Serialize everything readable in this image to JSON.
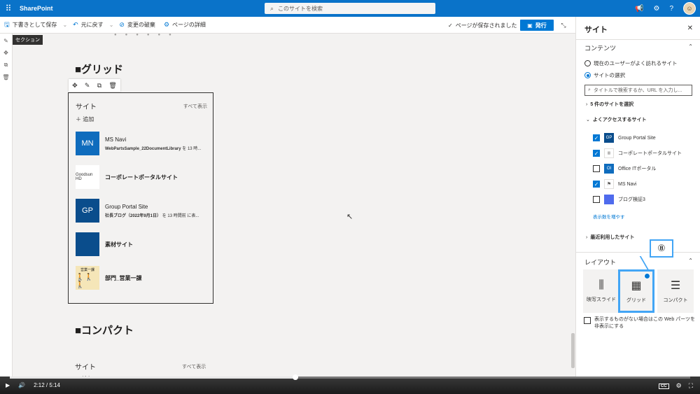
{
  "suitebar": {
    "app_name": "SharePoint",
    "search_placeholder": "このサイトを検索",
    "icons": [
      "waffle-icon",
      "megaphone-icon",
      "gear-icon",
      "help-icon",
      "avatar"
    ]
  },
  "cmdbar": {
    "save_draft": "下書きとして保存",
    "undo": "元に戻す",
    "discard": "変更の破棄",
    "page_details": "ページの詳細",
    "saved_status": "ページが保存されました",
    "publish": "発行"
  },
  "canvas": {
    "section_tag": "セクション",
    "grid_heading": "■グリッド",
    "compact_heading": "■コンパクト",
    "webpart": {
      "title": "サイト",
      "show_all": "すべて表示",
      "add": "追加",
      "sites": [
        {
          "tile_text": "MN",
          "tile_color": "#0f6cbd",
          "name": "MS Navi",
          "sub_bold": "WebPartsSample_22DocumentLibrary",
          "sub_rest": " を 13 時..."
        },
        {
          "tile_text": "Goodsun HD",
          "tile_color": "#ffffff",
          "name": "コーポレートポータルサイト",
          "sub_bold": "",
          "sub_rest": ""
        },
        {
          "tile_text": "GP",
          "tile_color": "#0a4d8c",
          "name": "Group Portal Site",
          "sub_bold": "社長ブログ（2022年9月1日）",
          "sub_rest": " を 13 時間前 に表..."
        },
        {
          "tile_text": "",
          "tile_color": "#0a4d8c",
          "name": "素材サイト",
          "sub_bold": "",
          "sub_rest": ""
        },
        {
          "tile_text": "営業一課",
          "tile_color": "#f5e6b8",
          "name": "部門_営業一課",
          "sub_bold": "",
          "sub_rest": ""
        }
      ]
    },
    "compact": {
      "title": "サイト",
      "show_all": "すべて表示",
      "add": "追加"
    }
  },
  "pane": {
    "title": "サイト",
    "content_group": "コンテンツ",
    "radio_frequent": "現在のユーザーがよく訪れるサイト",
    "radio_select": "サイトの選択",
    "filter_placeholder": "タイトルで検索するか、URL を入力し...",
    "selected_count": "5 件のサイトを選択",
    "frequent_header": "よくアクセスするサイト",
    "frequent_sites": [
      {
        "checked": true,
        "tile_text": "GP",
        "tile_color": "#0a4d8c",
        "name": "Group Portal Site"
      },
      {
        "checked": true,
        "tile_text": "",
        "tile_color": "#ffffff",
        "name": "コーポレートポータルサイト"
      },
      {
        "checked": false,
        "tile_text": "OI",
        "tile_color": "#0f6cbd",
        "name": "Office ITポータル"
      },
      {
        "checked": true,
        "tile_text": "",
        "tile_color": "#ffffff",
        "name": "MS Navi"
      },
      {
        "checked": false,
        "tile_text": "",
        "tile_color": "#4f6bed",
        "name": "ブログ検証3"
      }
    ],
    "show_more": "表示数を増やす",
    "recent_header": "最近利用したサイト",
    "layout_group": "レイアウト",
    "layouts": [
      "映写スライド",
      "グリッド",
      "コンパクト"
    ],
    "selected_layout": "グリッド",
    "callout": "⑧",
    "hide_label": "表示するものがない場合はこの Web パーツを非表示にする"
  },
  "player": {
    "time": "2:12 / 5:14",
    "progress": 0.42
  }
}
